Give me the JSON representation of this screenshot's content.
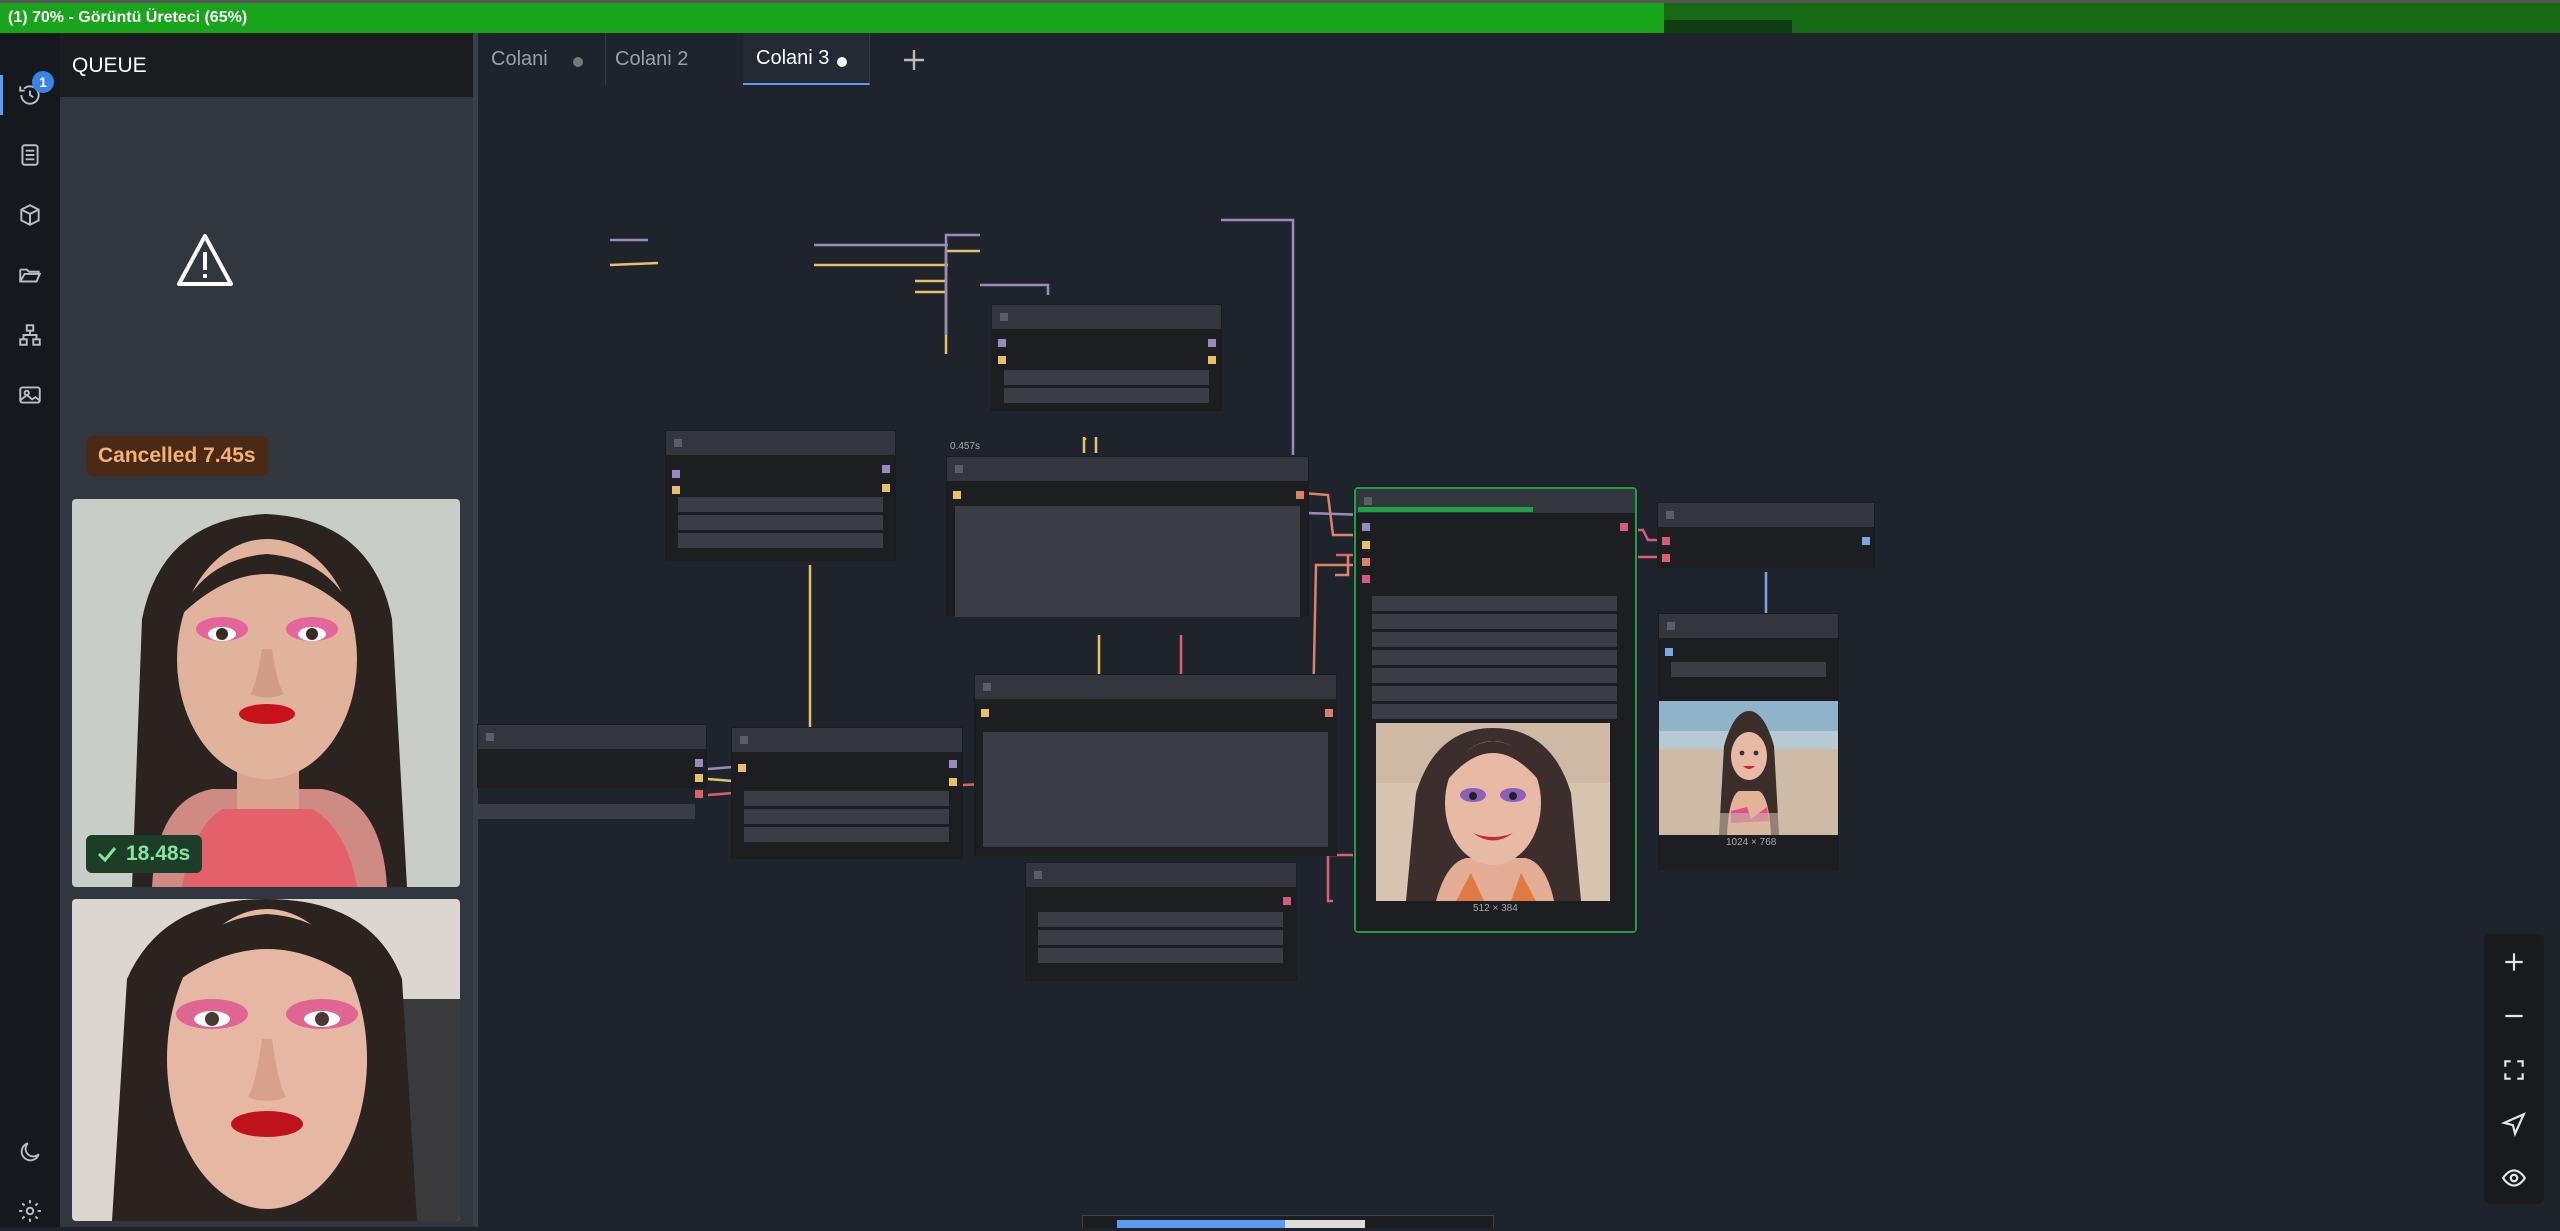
{
  "window": {
    "title": "(1) 70% - Görüntü Üreteci (65%)",
    "progress_percent": 65
  },
  "rail": {
    "queue_count": "1",
    "icons": [
      "queue-icon",
      "document-icon",
      "cube-icon",
      "folder-open-icon",
      "workflow-icon",
      "images-icon",
      "moon-icon",
      "gear-icon"
    ]
  },
  "sidebar": {
    "title": "QUEUE",
    "cancelled_label": "Cancelled 7.45s",
    "completed_time": "18.48s"
  },
  "tabs": [
    {
      "label": "Colani",
      "modified": true,
      "active": false
    },
    {
      "label": "Colani 2",
      "modified": false,
      "active": false
    },
    {
      "label": "Colani 3",
      "modified": true,
      "active": true
    }
  ],
  "canvas": {
    "execution_time": "0.457s",
    "preview_size_1": "512 × 384",
    "preview_size_2": "1024 × 768"
  },
  "zoom_controls": [
    "zoom-in-icon",
    "zoom-out-icon",
    "fit-view-icon",
    "locate-icon",
    "eye-icon"
  ],
  "colors": {
    "accent": "#5c9cf5",
    "progress": "#18a51c",
    "active_node_border": "#1fa14a",
    "cancelled": "#f3b17a",
    "success": "#86e3a0"
  }
}
